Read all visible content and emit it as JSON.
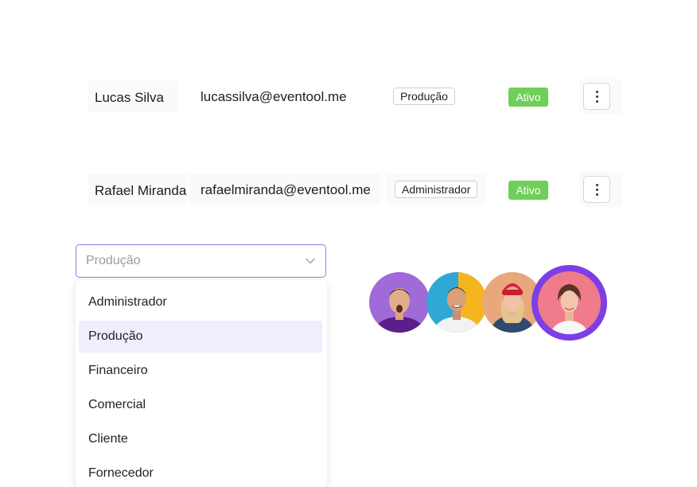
{
  "users": [
    {
      "name": "Lucas Silva",
      "email": "lucassilva@eventool.me",
      "role": "Produção",
      "status": "Ativo"
    },
    {
      "name": "Rafael Miranda",
      "email": "rafaelmiranda@eventool.me",
      "role": "Administrador",
      "status": "Ativo"
    }
  ],
  "role_select": {
    "value": "Produção",
    "options": [
      "Administrador",
      "Produção",
      "Financeiro",
      "Comercial",
      "Cliente",
      "Fornecedor"
    ],
    "selected_index": 1
  },
  "colors": {
    "accent": "#7c3fe6",
    "status_active": "#6fcf58",
    "select_border": "#8a7cf0",
    "option_selected_bg": "#f1edfd"
  },
  "avatars": [
    {
      "background": "#a06ad8"
    },
    {
      "background": "#2fa8d6"
    },
    {
      "background": "#e8a87c"
    },
    {
      "background": "#f07b8a",
      "highlighted": true
    }
  ],
  "icons": {
    "row_menu": "vertical-dots-icon",
    "select_toggle": "chevron-down-icon"
  }
}
